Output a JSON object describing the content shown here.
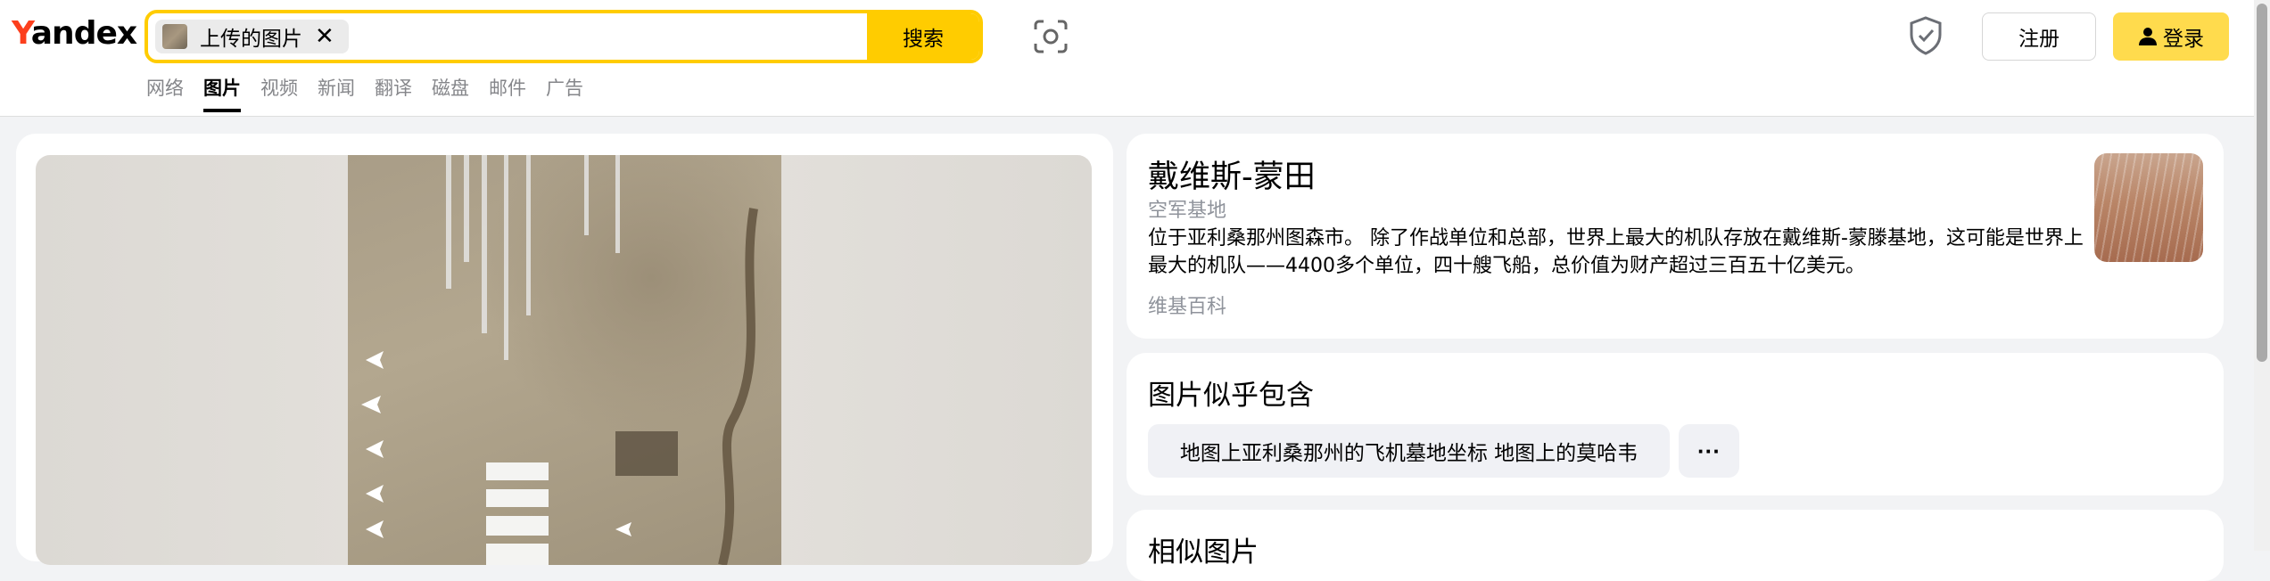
{
  "brand": {
    "logo_first": "Y",
    "logo_rest": "andex"
  },
  "search": {
    "chip_label": "上传的图片",
    "chip_close": "✕",
    "button_label": "搜索"
  },
  "tabs": [
    {
      "label": "网络"
    },
    {
      "label": "图片",
      "active": true
    },
    {
      "label": "视频"
    },
    {
      "label": "新闻"
    },
    {
      "label": "翻译"
    },
    {
      "label": "磁盘"
    },
    {
      "label": "邮件"
    },
    {
      "label": "广告"
    }
  ],
  "header_right": {
    "register_label": "注册",
    "login_label": "登录"
  },
  "info_card": {
    "title": "戴维斯-蒙田",
    "subtitle": "空军基地",
    "description": "位于亚利桑那州图森市。 除了作战单位和总部，世界上最大的机队存放在戴维斯-蒙滕基地，这可能是世界上最大的机队——4400多个单位，四十艘飞船，总价值为财产超过三百五十亿美元。",
    "source": "维基百科"
  },
  "contains_card": {
    "title": "图片似乎包含",
    "tag": "地图上亚利桑那州的飞机墓地坐标 地图上的莫哈韦",
    "more": "···"
  },
  "similar_card": {
    "title": "相似图片"
  },
  "colors": {
    "accent": "#ffcc00",
    "logo_red": "#fc3f1d",
    "login_bg": "#ffdb4d",
    "muted": "#8f939b"
  },
  "icons": [
    "image-thumb-icon",
    "close-icon",
    "camera-lens-icon",
    "shield-check-icon",
    "user-icon",
    "more-icon"
  ]
}
